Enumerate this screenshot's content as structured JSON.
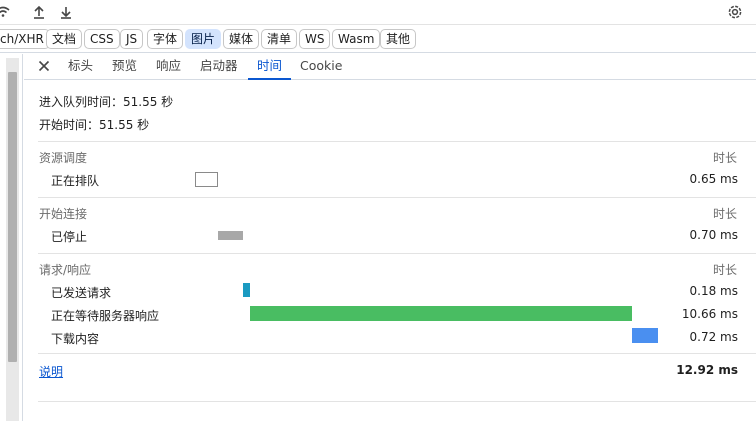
{
  "filters": [
    "ch/XHR",
    "文档",
    "CSS",
    "JS",
    "字体",
    "图片",
    "媒体",
    "清单",
    "WS",
    "Wasm",
    "其他"
  ],
  "active_filter": "图片",
  "tabs": [
    "标头",
    "预览",
    "响应",
    "启动器",
    "时间",
    "Cookie"
  ],
  "active_tab": "时间",
  "queued_at": "进入队列时间：51.55 秒",
  "started_at": "开始时间：51.55 秒",
  "duration_header": "时长",
  "sections": [
    {
      "title": "资源调度",
      "rows": [
        {
          "label": "正在排队",
          "value": "0.65 ms",
          "color": "#ffffff"
        }
      ]
    },
    {
      "title": "开始连接",
      "rows": [
        {
          "label": "已停止",
          "value": "0.70 ms",
          "color": "#a8a8a8"
        }
      ]
    },
    {
      "title": "请求/响应",
      "rows": [
        {
          "label": "已发送请求",
          "value": "0.18 ms",
          "color": "#1a9ac1"
        },
        {
          "label": "正在等待服务器响应",
          "value": "10.66 ms",
          "color": "#49bd62"
        },
        {
          "label": "下载内容",
          "value": "0.72 ms",
          "color": "#4a8ff0"
        }
      ]
    }
  ],
  "explain_link": "说明",
  "total": "12.92 ms",
  "colors": {
    "accent": "#0b57d0",
    "active_chip": "#d3e3fd"
  }
}
